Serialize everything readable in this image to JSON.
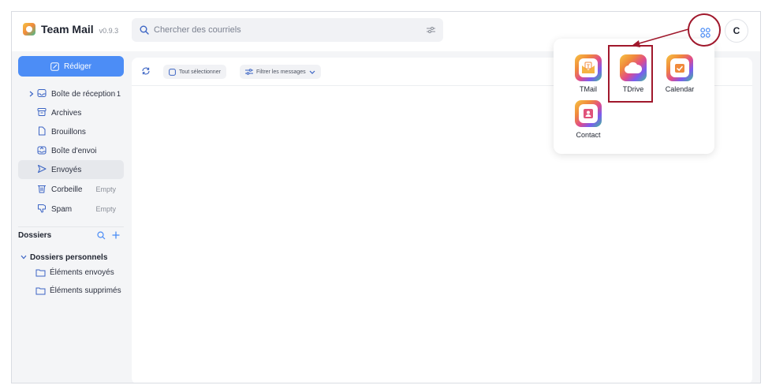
{
  "app": {
    "name": "Team Mail",
    "version": "v0.9.3",
    "avatar_initial": "C"
  },
  "search": {
    "placeholder": "Chercher des courriels"
  },
  "sidebar": {
    "compose_label": "Rédiger",
    "items": [
      {
        "label": "Boîte de réception",
        "count": "1"
      },
      {
        "label": "Archives"
      },
      {
        "label": "Brouillons"
      },
      {
        "label": "Boîte d'envoi"
      },
      {
        "label": "Envoyés"
      },
      {
        "label": "Corbeille",
        "status": "Empty"
      },
      {
        "label": "Spam",
        "status": "Empty"
      }
    ],
    "folders_title": "Dossiers",
    "personal_title": "Dossiers personnels",
    "folders": [
      {
        "label": "Éléments envoyés"
      },
      {
        "label": "Éléments supprimés"
      }
    ]
  },
  "toolbar": {
    "select_all": "Tout sélectionner",
    "filter": "Filtrer les messages"
  },
  "apps": [
    {
      "name": "TMail",
      "icon": "tmail-icon"
    },
    {
      "name": "TDrive",
      "icon": "cloud-icon"
    },
    {
      "name": "Calendar",
      "icon": "calendar-icon"
    },
    {
      "name": "Contact",
      "icon": "contact-icon"
    }
  ],
  "colors": {
    "accent": "#4c8df6",
    "highlight": "#a0182c"
  }
}
